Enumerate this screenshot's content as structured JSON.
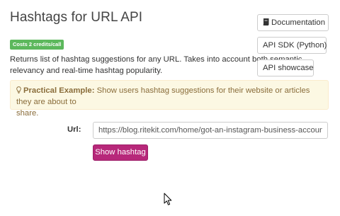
{
  "page": {
    "title": "Hashtags for URL API",
    "cost_badge": "Costs 2 credits/call",
    "description_line1": "Returns list of hashtag suggestions for any URL. Takes into account both semantic",
    "description_line2": "relevancy and real-time hashtag popularity."
  },
  "side_buttons": {
    "documentation": "Documentation",
    "sdk": "API SDK (Python)",
    "showcase": "API showcase"
  },
  "alert": {
    "label": "Practical Example:",
    "text_line1": " Show users hashtag suggestions for their website or articles they are about to",
    "text_line2": "share."
  },
  "form": {
    "url_label": "Url:",
    "url_value": "https://blog.ritekit.com/home/got-an-instagram-business-account-ritetag",
    "submit_label": "Show hashtag"
  },
  "icons": {
    "documentation": "book-icon",
    "alert": "lightbulb-icon",
    "cursor": "mouse-pointer-icon"
  },
  "colors": {
    "badge": "#5cb85c",
    "submit": "#b7287a",
    "alert_bg": "#fcf8e3",
    "alert_text": "#8a6d3b"
  }
}
